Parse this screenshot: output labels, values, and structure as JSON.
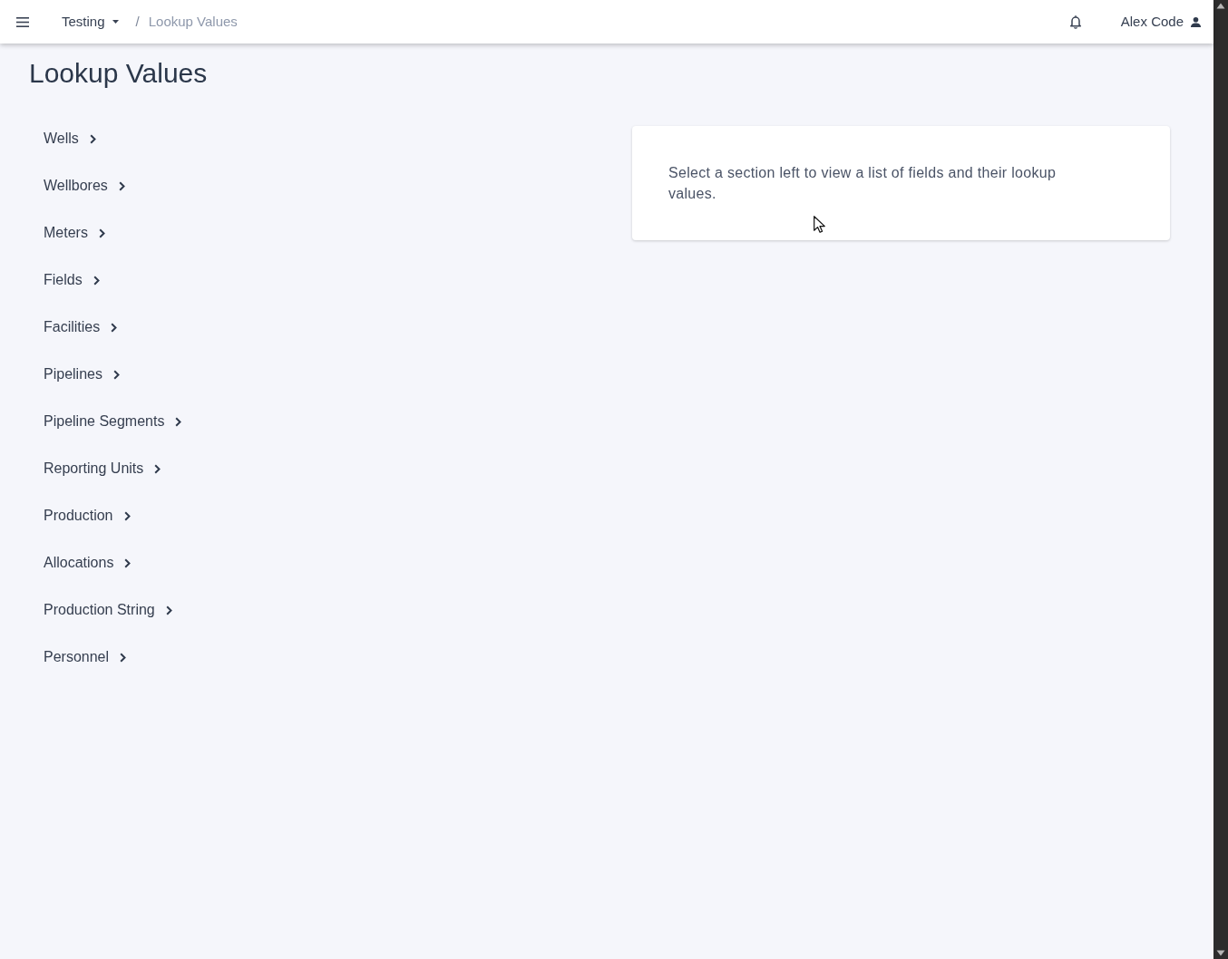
{
  "topbar": {
    "breadcrumb": {
      "separator": "/",
      "items": [
        {
          "label": "Testing",
          "kind": "dropdown"
        },
        {
          "label": "Lookup Values",
          "kind": "current"
        }
      ]
    },
    "user": {
      "name": "Alex Code"
    }
  },
  "page": {
    "title": "Lookup Values"
  },
  "sections": [
    {
      "label": "Wells"
    },
    {
      "label": "Wellbores"
    },
    {
      "label": "Meters"
    },
    {
      "label": "Fields"
    },
    {
      "label": "Facilities"
    },
    {
      "label": "Pipelines"
    },
    {
      "label": "Pipeline Segments"
    },
    {
      "label": "Reporting Units"
    },
    {
      "label": "Production"
    },
    {
      "label": "Allocations"
    },
    {
      "label": "Production String"
    },
    {
      "label": "Personnel"
    }
  ],
  "info_card": {
    "message": "Select a section left to view a list of fields and their lookup values."
  }
}
